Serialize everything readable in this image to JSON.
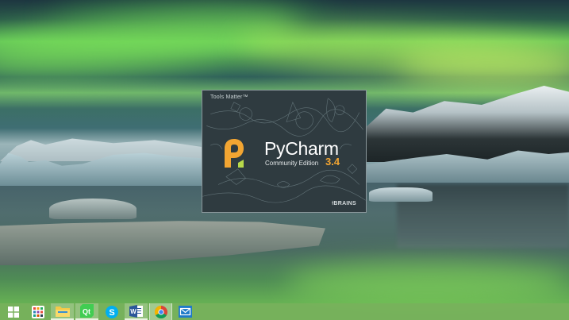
{
  "splash": {
    "tagline": "Tools Matter™",
    "product_name": "PyCharm",
    "edition": "Community Edition",
    "version": "3.4",
    "vendor": "BRAINS",
    "brand_colors": {
      "orange": "#f2a532",
      "panel": "#2f3b40"
    }
  },
  "taskbar": {
    "items": [
      {
        "id": "start",
        "icon": "windows-logo-icon"
      },
      {
        "id": "apps",
        "icon": "app-grid-icon"
      },
      {
        "id": "explorer",
        "icon": "folder-icon"
      },
      {
        "id": "qt",
        "icon": "qt-creator-icon"
      },
      {
        "id": "skype",
        "icon": "skype-icon"
      },
      {
        "id": "word",
        "icon": "word-icon"
      },
      {
        "id": "chrome",
        "icon": "chrome-icon"
      },
      {
        "id": "mail",
        "icon": "mail-icon"
      }
    ]
  }
}
